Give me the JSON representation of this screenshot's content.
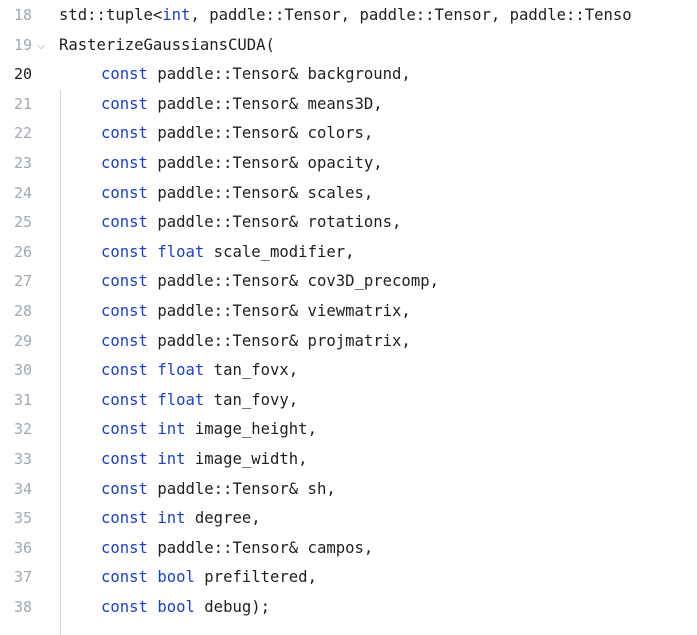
{
  "editor": {
    "lines": [
      {
        "number": "18",
        "parts": [
          {
            "t": "std::tuple<",
            "k": false
          },
          {
            "t": "int",
            "k": true
          },
          {
            "t": ", paddle::Tensor, paddle::Tensor, paddle::Tenso",
            "k": false
          }
        ]
      },
      {
        "number": "19",
        "fold": "⌵",
        "parts": [
          {
            "t": "RasterizeGaussiansCUDA(",
            "k": false
          }
        ]
      },
      {
        "number": "20",
        "active": true,
        "parts": [
          {
            "t": "const",
            "k": true
          },
          {
            "t": " paddle::Tensor& background,",
            "k": false
          }
        ]
      },
      {
        "number": "21",
        "parts": [
          {
            "t": "const",
            "k": true
          },
          {
            "t": " paddle::Tensor& means3D,",
            "k": false
          }
        ]
      },
      {
        "number": "22",
        "parts": [
          {
            "t": "const",
            "k": true
          },
          {
            "t": " paddle::Tensor& colors,",
            "k": false
          }
        ]
      },
      {
        "number": "23",
        "parts": [
          {
            "t": "const",
            "k": true
          },
          {
            "t": " paddle::Tensor& opacity,",
            "k": false
          }
        ]
      },
      {
        "number": "24",
        "parts": [
          {
            "t": "const",
            "k": true
          },
          {
            "t": " paddle::Tensor& scales,",
            "k": false
          }
        ]
      },
      {
        "number": "25",
        "parts": [
          {
            "t": "const",
            "k": true
          },
          {
            "t": " paddle::Tensor& rotations,",
            "k": false
          }
        ]
      },
      {
        "number": "26",
        "parts": [
          {
            "t": "const",
            "k": true
          },
          {
            "t": " ",
            "k": false
          },
          {
            "t": "float",
            "k": true
          },
          {
            "t": " scale_modifier,",
            "k": false
          }
        ]
      },
      {
        "number": "27",
        "parts": [
          {
            "t": "const",
            "k": true
          },
          {
            "t": " paddle::Tensor& cov3D_precomp,",
            "k": false
          }
        ]
      },
      {
        "number": "28",
        "parts": [
          {
            "t": "const",
            "k": true
          },
          {
            "t": " paddle::Tensor& viewmatrix,",
            "k": false
          }
        ]
      },
      {
        "number": "29",
        "parts": [
          {
            "t": "const",
            "k": true
          },
          {
            "t": " paddle::Tensor& projmatrix,",
            "k": false
          }
        ]
      },
      {
        "number": "30",
        "parts": [
          {
            "t": "const",
            "k": true
          },
          {
            "t": " ",
            "k": false
          },
          {
            "t": "float",
            "k": true
          },
          {
            "t": " tan_fovx,",
            "k": false
          }
        ]
      },
      {
        "number": "31",
        "parts": [
          {
            "t": "const",
            "k": true
          },
          {
            "t": " ",
            "k": false
          },
          {
            "t": "float",
            "k": true
          },
          {
            "t": " tan_fovy,",
            "k": false
          }
        ]
      },
      {
        "number": "32",
        "parts": [
          {
            "t": "const",
            "k": true
          },
          {
            "t": " ",
            "k": false
          },
          {
            "t": "int",
            "k": true
          },
          {
            "t": " image_height,",
            "k": false
          }
        ]
      },
      {
        "number": "33",
        "parts": [
          {
            "t": "const",
            "k": true
          },
          {
            "t": " ",
            "k": false
          },
          {
            "t": "int",
            "k": true
          },
          {
            "t": " image_width,",
            "k": false
          }
        ]
      },
      {
        "number": "34",
        "parts": [
          {
            "t": "const",
            "k": true
          },
          {
            "t": " paddle::Tensor& sh,",
            "k": false
          }
        ]
      },
      {
        "number": "35",
        "parts": [
          {
            "t": "const",
            "k": true
          },
          {
            "t": " ",
            "k": false
          },
          {
            "t": "int",
            "k": true
          },
          {
            "t": " degree,",
            "k": false
          }
        ]
      },
      {
        "number": "36",
        "parts": [
          {
            "t": "const",
            "k": true
          },
          {
            "t": " paddle::Tensor& campos,",
            "k": false
          }
        ]
      },
      {
        "number": "37",
        "parts": [
          {
            "t": "const",
            "k": true
          },
          {
            "t": " ",
            "k": false
          },
          {
            "t": "bool",
            "k": true
          },
          {
            "t": " prefiltered,",
            "k": false
          }
        ]
      },
      {
        "number": "38",
        "parts": [
          {
            "t": "const",
            "k": true
          },
          {
            "t": " ",
            "k": false
          },
          {
            "t": "bool",
            "k": true
          },
          {
            "t": " debug);",
            "k": false
          }
        ]
      }
    ]
  },
  "colors": {
    "keyword": "#1a3fd0",
    "text": "#1f1f1f",
    "line_number": "#a0a8b0",
    "line_number_active": "#1b1b1b",
    "background": "#ffffff"
  }
}
